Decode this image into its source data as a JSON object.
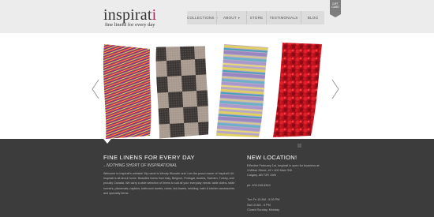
{
  "header": {
    "logo_main": "inspirat",
    "logo_accent": "i",
    "tagline": "fine linens for every day",
    "ribbon": "GIFT CARD",
    "nav": [
      {
        "label": "COLLECTIONS",
        "has_caret": true
      },
      {
        "label": "ABOUT",
        "has_caret": true
      },
      {
        "label": "STORE",
        "has_caret": false
      },
      {
        "label": "TESTIMONIALS",
        "has_caret": false
      },
      {
        "label": "BLOG",
        "has_caret": false
      }
    ],
    "caret_glyph": "▾"
  },
  "slider": {
    "prev_icon": "chevron-left-icon",
    "next_icon": "chevron-right-icon"
  },
  "left_column": {
    "heading": "FINE LINENS FOR EVERY DAY",
    "subheading": "...NOTHING SHORT OF INSPIRATIONAL",
    "paragraph": "Welcome to Inspirati's website! My name is Wendy Wooster and I am the proud owner of Inspirati Ltd. Inspirati is all about home. Beautiful linens from Italy, Belgium, Portugal, Austria, Sweden, Turkey, and proudly Canada. We carry a wide selection of linens to suit all your everyday needs: table cloths, table runners, placemats, napkins, bathroom towels, robes, tea towels, bedding, bath & kitchen accessories and specialty items."
  },
  "right_column": {
    "heading": "NEW LOCATION!",
    "lines": [
      "Effective February 1st, Inspirati is open for business at:",
      "3 Milton Street, #2  •  400 Main SW",
      "Calgary, AB T2R 1W6",
      "",
      "ph: 403.245.6343",
      "",
      "",
      "Tue-Fri 10 AM - 5:30 PM",
      "Sat 10 AM - 5 PM",
      "Closed Sunday, Monday"
    ]
  },
  "colors": {
    "accent": "#c8186c",
    "header_bg": "#ececec",
    "footer_bg": "#3c3c3c"
  }
}
